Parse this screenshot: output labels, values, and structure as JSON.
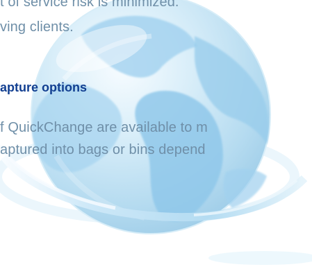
{
  "document": {
    "line_1": "t of service risk is minimized. ",
    "line_2": "ving clients.",
    "heading": "apture options",
    "line_3": "f QuickChange are available to m",
    "line_4": "aptured into bags or bins depend"
  },
  "illustration": {
    "globe": "globe-illustration-icon",
    "accent": "#b7dff7",
    "ocean": "#d8eef9",
    "land": "#8fc7ea"
  }
}
